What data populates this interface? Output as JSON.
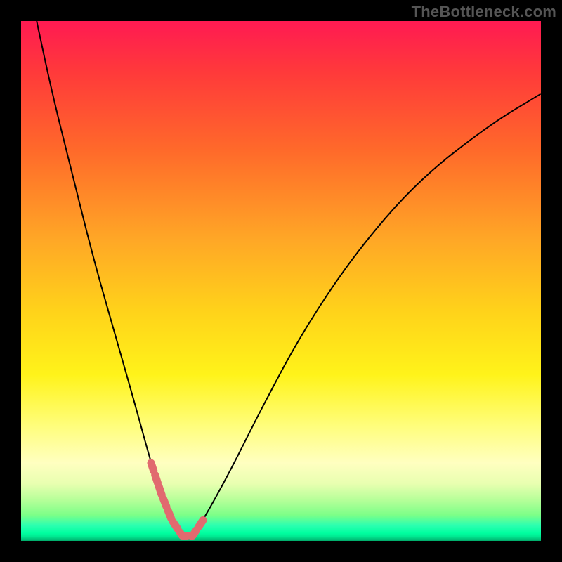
{
  "watermark": {
    "text": "TheBottleneck.com"
  },
  "chart_data": {
    "type": "line",
    "title": "",
    "xlabel": "",
    "ylabel": "",
    "xlim": [
      0,
      100
    ],
    "ylim": [
      0,
      100
    ],
    "grid": false,
    "legend": false,
    "background_gradient": {
      "direction": "top-to-bottom",
      "stops": [
        {
          "pos": 0.0,
          "color": "#ff1a52"
        },
        {
          "pos": 0.25,
          "color": "#ff6a2a"
        },
        {
          "pos": 0.55,
          "color": "#ffd31a"
        },
        {
          "pos": 0.8,
          "color": "#fffe7d"
        },
        {
          "pos": 0.92,
          "color": "#b8ff9a"
        },
        {
          "pos": 1.0,
          "color": "#00aa6a"
        }
      ]
    },
    "series": [
      {
        "name": "bottleneck-curve",
        "type": "line",
        "color": "#000000",
        "x": [
          3,
          6,
          10,
          14,
          18,
          22,
          25,
          27,
          29,
          31,
          33,
          35,
          40,
          46,
          54,
          64,
          76,
          90,
          100
        ],
        "y": [
          100,
          86,
          70,
          54,
          40,
          26,
          15,
          9,
          4,
          1,
          1,
          4,
          13,
          25,
          40,
          55,
          69,
          80,
          86
        ]
      }
    ],
    "highlight": {
      "name": "optimal-region",
      "color": "#e16a6f",
      "style": "dashed",
      "x": [
        25,
        27,
        29,
        31,
        33,
        35
      ],
      "y": [
        15,
        9,
        4,
        1,
        1,
        4
      ]
    }
  }
}
